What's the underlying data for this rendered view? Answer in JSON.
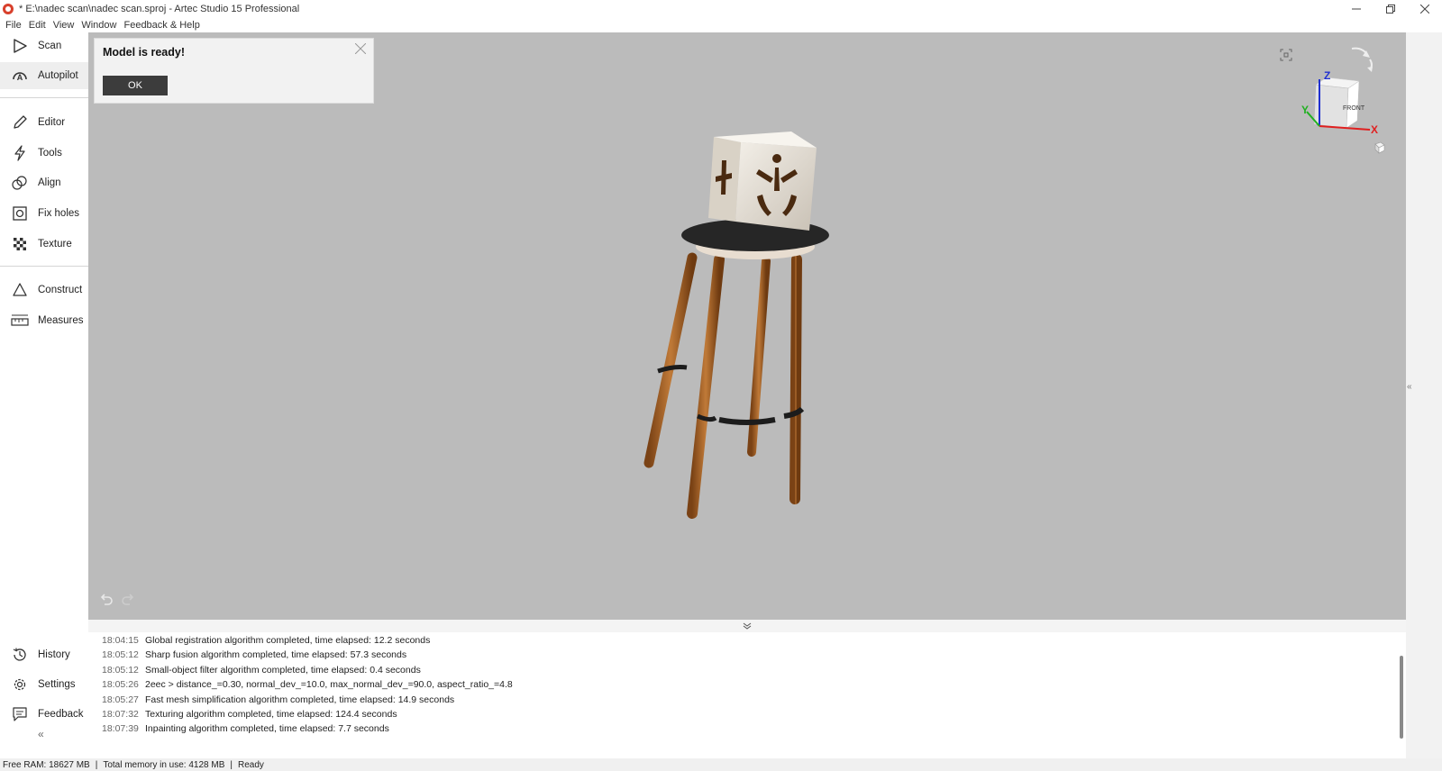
{
  "window": {
    "title": "* E:\\nadec scan\\nadec scan.sproj - Artec Studio 15 Professional"
  },
  "menu": [
    "File",
    "Edit",
    "View",
    "Window",
    "Feedback & Help"
  ],
  "sidebar": {
    "items": [
      {
        "label": "Scan",
        "icon": "play-icon"
      },
      {
        "label": "Autopilot",
        "icon": "autopilot-icon"
      },
      {
        "label": "Editor",
        "icon": "pencil-icon"
      },
      {
        "label": "Tools",
        "icon": "lightning-icon"
      },
      {
        "label": "Align",
        "icon": "align-icon"
      },
      {
        "label": "Fix holes",
        "icon": "fix-holes-icon"
      },
      {
        "label": "Texture",
        "icon": "checker-icon"
      },
      {
        "label": "Construct",
        "icon": "triangle-icon"
      },
      {
        "label": "Measures",
        "icon": "ruler-icon"
      }
    ],
    "bottom": [
      {
        "label": "History",
        "icon": "history-icon"
      },
      {
        "label": "Settings",
        "icon": "gear-icon"
      },
      {
        "label": "Feedback",
        "icon": "feedback-icon"
      }
    ],
    "collapse": "«"
  },
  "dialog": {
    "title": "Model is ready!",
    "ok": "OK"
  },
  "viewcube": {
    "face": "FRONT",
    "axes": {
      "x": "X",
      "y": "Y",
      "z": "Z"
    },
    "colors": {
      "x": "#e02020",
      "y": "#20b020",
      "z": "#2030d0"
    }
  },
  "log": [
    {
      "time": "18:04:15",
      "msg": "Global registration algorithm completed, time elapsed: 12.2 seconds"
    },
    {
      "time": "18:05:12",
      "msg": "Sharp fusion algorithm completed, time elapsed: 57.3 seconds"
    },
    {
      "time": "18:05:12",
      "msg": "Small-object filter algorithm completed, time elapsed: 0.4 seconds"
    },
    {
      "time": "18:05:26",
      "msg": "2eec > distance_=0.30, normal_dev_=10.0, max_normal_dev_=90.0, aspect_ratio_=4.8"
    },
    {
      "time": "18:05:27",
      "msg": "Fast mesh simplification algorithm completed, time elapsed: 14.9 seconds"
    },
    {
      "time": "18:07:32",
      "msg": "Texturing algorithm completed, time elapsed: 124.4 seconds"
    },
    {
      "time": "18:07:39",
      "msg": "Inpainting algorithm completed, time elapsed: 7.7 seconds"
    }
  ],
  "status": {
    "free_ram": "Free RAM: 18627 MB",
    "total_memory": "Total memory in use: 4128 MB",
    "state": "Ready",
    "sep": "|"
  }
}
